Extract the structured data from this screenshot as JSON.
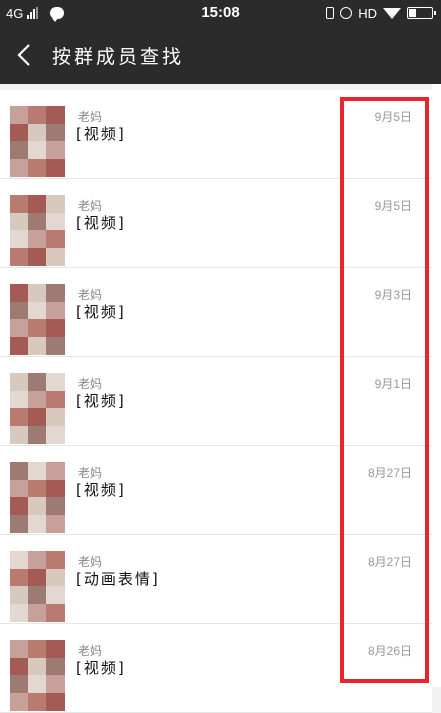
{
  "status_bar": {
    "network": "4G",
    "time": "15:08",
    "hd": "HD"
  },
  "header": {
    "title": "按群成员查找"
  },
  "messages": [
    {
      "sender": "老妈",
      "content": "[视频]",
      "date": "9月5日"
    },
    {
      "sender": "老妈",
      "content": "[视频]",
      "date": "9月5日"
    },
    {
      "sender": "老妈",
      "content": "[视频]",
      "date": "9月3日"
    },
    {
      "sender": "老妈",
      "content": "[视频]",
      "date": "9月1日"
    },
    {
      "sender": "老妈",
      "content": "[视频]",
      "date": "8月27日"
    },
    {
      "sender": "老妈",
      "content": "[动画表情]",
      "date": "8月27日"
    },
    {
      "sender": "老妈",
      "content": "[视频]",
      "date": "8月26日"
    }
  ],
  "colors": {
    "header_bg": "#2b2b2b",
    "highlight": "#e8242d",
    "avatar_mosaic": [
      "#c8a09a",
      "#b97a70",
      "#a45a55",
      "#d8c9bf",
      "#9d7b72",
      "#e3d8d1"
    ]
  }
}
